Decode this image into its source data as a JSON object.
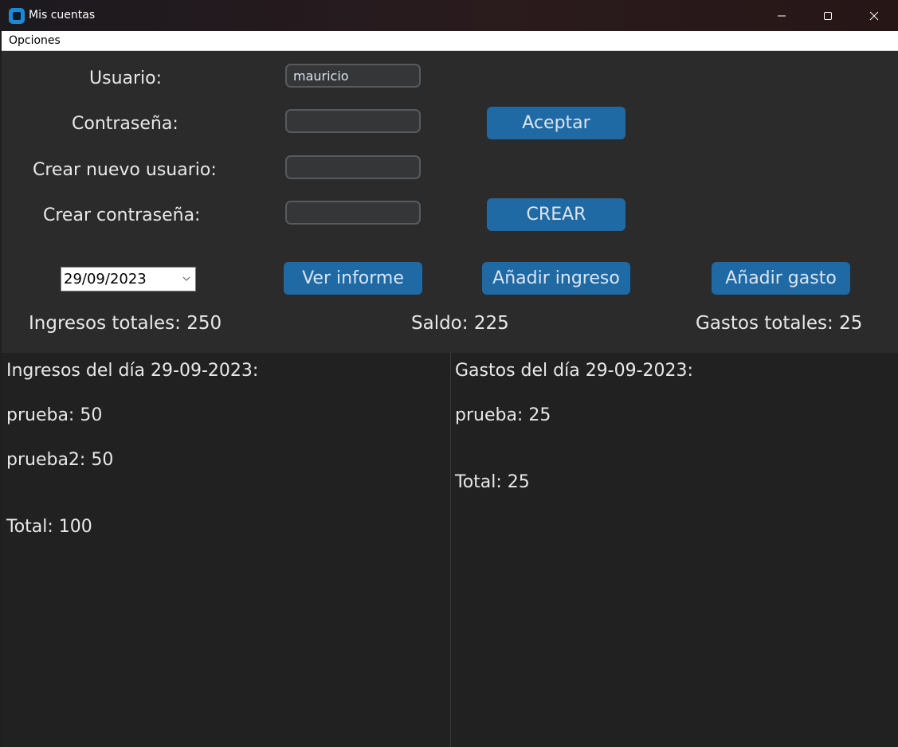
{
  "window": {
    "title": "Mis cuentas",
    "controls": [
      "minimize-icon",
      "maximize-icon",
      "close-icon"
    ]
  },
  "menubar": {
    "items": [
      {
        "label": "Opciones"
      }
    ]
  },
  "form": {
    "usuario_label": "Usuario:",
    "usuario_value": "mauricio",
    "contrasena_label": "Contraseña:",
    "contrasena_value": "",
    "crear_usuario_label": "Crear nuevo usuario:",
    "crear_usuario_value": "",
    "crear_contrasena_label": "Crear contraseña:",
    "crear_contrasena_value": "",
    "aceptar_button": "Aceptar",
    "crear_button": "CREAR"
  },
  "actions": {
    "date_value": "29/09/2023",
    "ver_informe": "Ver informe",
    "anadir_ingreso": "Añadir ingreso",
    "anadir_gasto": "Añadir gasto"
  },
  "summary": {
    "ingresos_totales": "Ingresos totales: 250",
    "saldo": "Saldo: 225",
    "gastos_totales": "Gastos totales: 25"
  },
  "ingresos_panel": {
    "title": "Ingresos del día 29-09-2023:",
    "items": [
      "prueba: 50",
      "prueba2: 50"
    ],
    "total": "Total: 100"
  },
  "gastos_panel": {
    "title": "Gastos del día 29-09-2023:",
    "items": [
      "prueba: 25"
    ],
    "total": "Total: 25"
  },
  "colors": {
    "accent_button": "#1f6aa5",
    "form_background": "#2b2b2b",
    "panel_background": "#212121"
  }
}
